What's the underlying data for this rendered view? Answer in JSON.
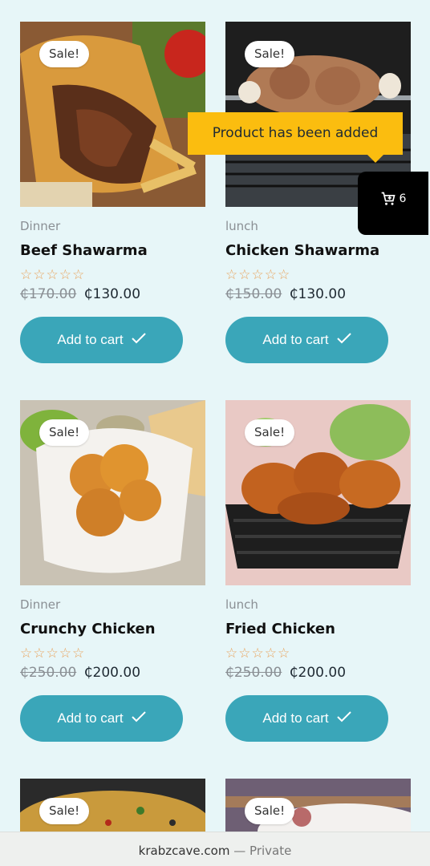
{
  "products": [
    {
      "category": "Dinner",
      "name": "Beef Shawarma",
      "old_price": "₵170.00",
      "price": "₵130.00",
      "badge": "Sale!",
      "button": "Add to cart",
      "rating_stars": "☆☆☆☆☆"
    },
    {
      "category": "lunch",
      "name": "Chicken Shawarma",
      "old_price": "₵150.00",
      "price": "₵130.00",
      "badge": "Sale!",
      "button": "Add to cart",
      "rating_stars": "☆☆☆☆☆"
    },
    {
      "category": "Dinner",
      "name": "Crunchy Chicken",
      "old_price": "₵250.00",
      "price": "₵200.00",
      "badge": "Sale!",
      "button": "Add to cart",
      "rating_stars": "☆☆☆☆☆"
    },
    {
      "category": "lunch",
      "name": "Fried Chicken",
      "old_price": "₵250.00",
      "price": "₵200.00",
      "badge": "Sale!",
      "button": "Add to cart",
      "rating_stars": "☆☆☆☆☆"
    },
    {
      "badge": "Sale!"
    },
    {
      "badge": "Sale!"
    }
  ],
  "toast": {
    "message": "Product has been added"
  },
  "cart": {
    "count": "6",
    "icon": "cart-add-icon"
  },
  "browser_footer": {
    "domain": "krabzcave.com",
    "separator": "—",
    "mode": "Private"
  },
  "colors": {
    "background": "#e7f6f8",
    "button": "#3aa6b9",
    "toast": "#fbbd0f",
    "cart": "#000000",
    "stars": "#e8a25a"
  }
}
